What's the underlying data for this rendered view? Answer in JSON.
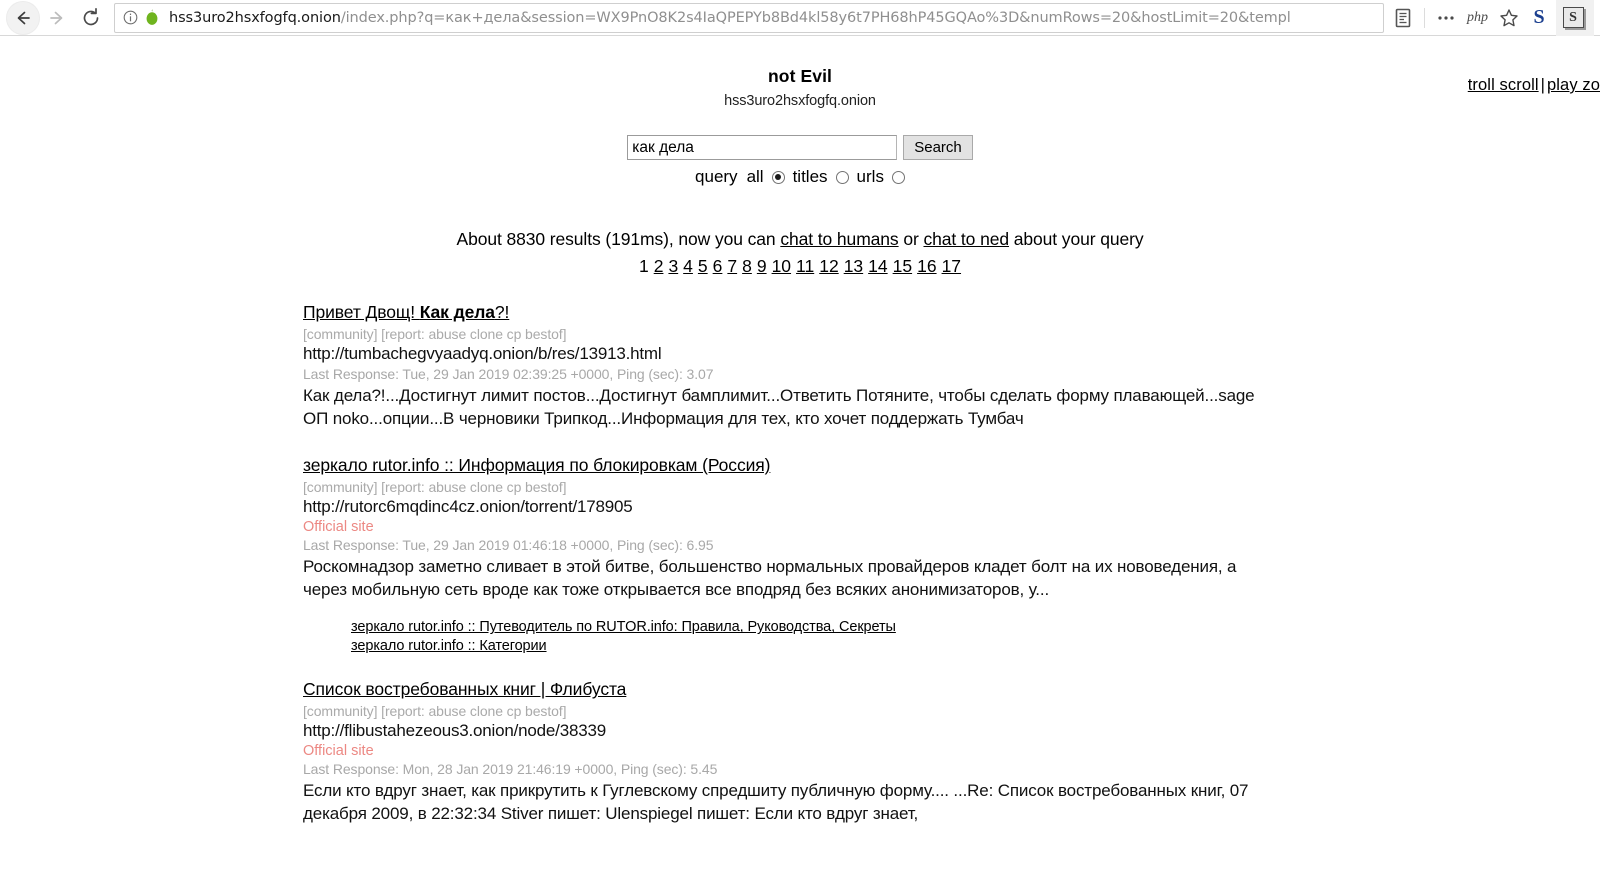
{
  "browser": {
    "back_label": "Back",
    "forward_label": "Forward",
    "reload_label": "Reload",
    "url_host": "hss3uro2hsxfogfq.onion",
    "url_path": "/index.php?q=как+дела&session=WX9PnO8K2s4IaQPEPYb8Bd4kl58y6t7PH68hP45GQAo%3D&numRows=20&hostLimit=20&templ",
    "site_info_icon": "info-icon",
    "onion_icon": "onion-icon",
    "toolbar": {
      "reader_icon": "reader-view-icon",
      "overflow_icon": "overflow-menu-icon",
      "php_label": "php",
      "bookmark_icon": "star-bookmark-icon",
      "skype_label": "S",
      "extension_label": "S"
    }
  },
  "page": {
    "corner_links": [
      {
        "label": "troll scroll"
      },
      {
        "label": "play zo"
      }
    ],
    "corner_separator": "|",
    "site_title": "not Evil",
    "site_domain": "hss3uro2hsxfogfq.onion",
    "search": {
      "value": "как дела",
      "placeholder": "",
      "button_label": "Search",
      "scope_label": "query",
      "options": [
        {
          "label": "all",
          "checked": true
        },
        {
          "label": "titles",
          "checked": false
        },
        {
          "label": "urls",
          "checked": false
        }
      ]
    },
    "summary": {
      "prefix": "About 8830 results (191ms), now you can ",
      "link1": "chat to humans",
      "middle": " or ",
      "link2": "chat to ned",
      "suffix": " about your query"
    },
    "pagination": {
      "current": "1",
      "pages": [
        "2",
        "3",
        "4",
        "5",
        "6",
        "7",
        "8",
        "9",
        "10",
        "11",
        "12",
        "13",
        "14",
        "15",
        "16",
        "17"
      ]
    },
    "results": [
      {
        "title_plain1": "Привет Двощ! ",
        "title_bold": "Как дела",
        "title_plain2": "?!",
        "tags": "[community] [report: abuse clone cp bestof]",
        "url": "http://tumbachegvyaadyq.onion/b/res/13913.html",
        "official": "",
        "meta": "Last Response: Tue, 29 Jan 2019 02:39:25 +0000, Ping (sec): 3.07",
        "snippet": "Как дела?!...Достигнут лимит постов...Достигнут бамплимит...Ответить Потяните, чтобы сделать форму плавающей...sage ОП noko...опции...В черновики Трипкод...Информация для тех, кто хочет поддержать Тумбач",
        "sublinks": []
      },
      {
        "title_plain1": "зеркало rutor.info :: Информация по блокировкам (Россия)",
        "title_bold": "",
        "title_plain2": "",
        "tags": "[community] [report: abuse clone cp bestof]",
        "url": "http://rutorc6mqdinc4cz.onion/torrent/178905",
        "official": "Official site",
        "meta": "Last Response: Tue, 29 Jan 2019 01:46:18 +0000, Ping (sec): 6.95",
        "snippet": "Роскомнадзор заметно сливает в этой битве, большенство нормальных провайдеров кладет болт на их нововедения, а через мобильную сеть вроде как тоже открывается все вподряд без всяких анонимизаторов, у...",
        "sublinks": [
          "зеркало rutor.info :: Путеводитель по RUTOR.info: Правила, Руководства, Секреты",
          "зеркало rutor.info :: Категории"
        ]
      },
      {
        "title_plain1": "Список востребованных книг | Флибуста",
        "title_bold": "",
        "title_plain2": "",
        "tags": "[community] [report: abuse clone cp bestof]",
        "url": "http://flibustahezeous3.onion/node/38339",
        "official": "Official site",
        "meta": "Last Response: Mon, 28 Jan 2019 21:46:19 +0000, Ping (sec): 5.45",
        "snippet": "Если кто вдруг знает, как прикрутить к Гуглевскому спредшиту публичную форму.... ...Re: Список востребованных книг, 07 декабря 2009, в 22:32:34 Stiver пишет: Ulenspiegel пишет: Если кто вдруг знает,",
        "sublinks": []
      }
    ]
  }
}
